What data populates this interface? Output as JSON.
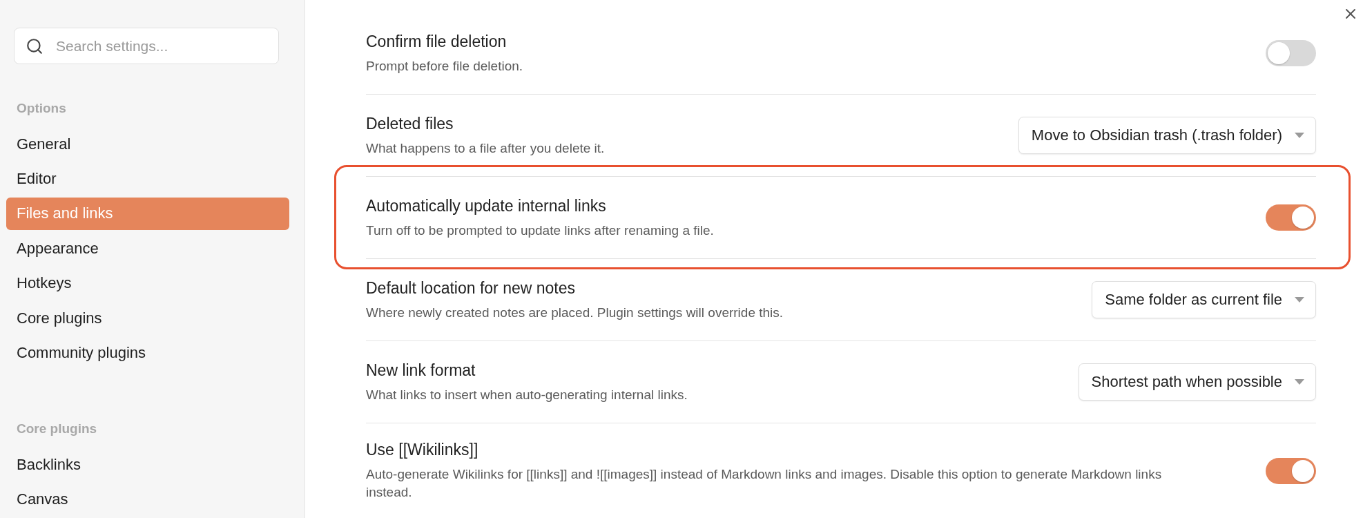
{
  "search": {
    "placeholder": "Search settings..."
  },
  "sidebar": {
    "sections": [
      {
        "heading": "Options",
        "items": [
          {
            "label": "General",
            "selected": false
          },
          {
            "label": "Editor",
            "selected": false
          },
          {
            "label": "Files and links",
            "selected": true
          },
          {
            "label": "Appearance",
            "selected": false
          },
          {
            "label": "Hotkeys",
            "selected": false
          },
          {
            "label": "Core plugins",
            "selected": false
          },
          {
            "label": "Community plugins",
            "selected": false
          }
        ]
      },
      {
        "heading": "Core plugins",
        "items": [
          {
            "label": "Backlinks",
            "selected": false
          },
          {
            "label": "Canvas",
            "selected": false
          }
        ]
      }
    ]
  },
  "settings": [
    {
      "kind": "toggle",
      "title": "Confirm file deletion",
      "description": "Prompt before file deletion.",
      "on": false,
      "highlighted": false
    },
    {
      "kind": "dropdown",
      "title": "Deleted files",
      "description": "What happens to a file after you delete it.",
      "value": "Move to Obsidian trash (.trash folder)",
      "highlighted": false
    },
    {
      "kind": "toggle",
      "title": "Automatically update internal links",
      "description": "Turn off to be prompted to update links after renaming a file.",
      "on": true,
      "highlighted": true
    },
    {
      "kind": "dropdown",
      "title": "Default location for new notes",
      "description": "Where newly created notes are placed. Plugin settings will override this.",
      "value": "Same folder as current file",
      "highlighted": false
    },
    {
      "kind": "dropdown",
      "title": "New link format",
      "description": "What links to insert when auto-generating internal links.",
      "value": "Shortest path when possible",
      "highlighted": false
    },
    {
      "kind": "toggle",
      "title": "Use [[Wikilinks]]",
      "description": "Auto-generate Wikilinks for [[links]] and ![[images]] instead of Markdown links and images. Disable this option to generate Markdown links instead.",
      "on": true,
      "highlighted": false
    }
  ]
}
